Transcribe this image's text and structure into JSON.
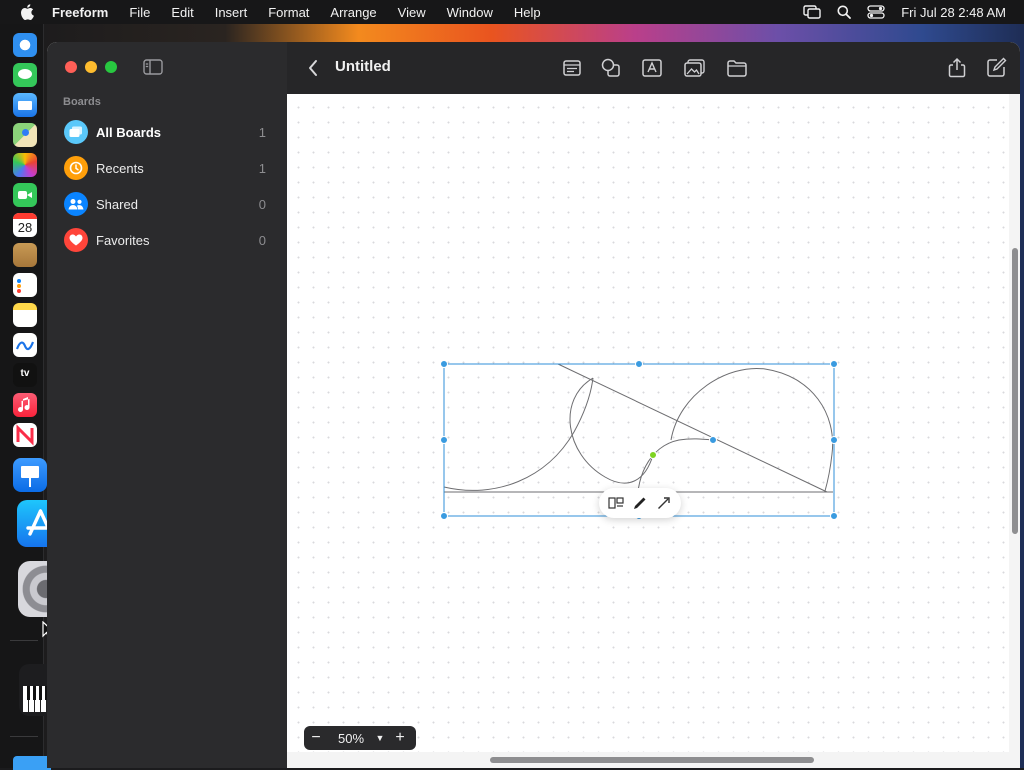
{
  "menubar": {
    "app_name": "Freeform",
    "items": [
      "File",
      "Edit",
      "Insert",
      "Format",
      "Arrange",
      "View",
      "Window",
      "Help"
    ],
    "clock": "Fri Jul 28  2:48 AM"
  },
  "dock": {
    "apps": [
      "safari",
      "messages",
      "mail",
      "maps",
      "photos",
      "facetime",
      "calendar",
      "notes-brown",
      "reminders",
      "notes",
      "freeform",
      "tv",
      "music",
      "news",
      "keynote",
      "app-store",
      "system-settings",
      "piano",
      "finder-folder"
    ],
    "calendar_day": "28",
    "tv_label": "tv"
  },
  "sidebar": {
    "section_title": "Boards",
    "items": [
      {
        "label": "All Boards",
        "count": "1",
        "icon": "boards-icon",
        "color": "#5ac8fa"
      },
      {
        "label": "Recents",
        "count": "1",
        "icon": "clock-icon",
        "color": "#ff9f0a"
      },
      {
        "label": "Shared",
        "count": "0",
        "icon": "people-icon",
        "color": "#0a84ff"
      },
      {
        "label": "Favorites",
        "count": "0",
        "icon": "heart-icon",
        "color": "#ff453a"
      }
    ]
  },
  "toolbar": {
    "title": "Untitled",
    "tools": [
      "sticky-note-icon",
      "shapes-icon",
      "text-box-icon",
      "media-icon",
      "files-icon"
    ],
    "actions": [
      "share-icon",
      "new-board-icon"
    ]
  },
  "canvas": {
    "selection_color": "#2f8fd8",
    "handle_color": "#3a9be0",
    "control_point_color": "#7ed321",
    "context_toolbar": [
      "arrange-icon",
      "pen-icon",
      "connector-icon"
    ]
  },
  "zoom": {
    "value": "50%",
    "minus": "−",
    "plus": "+"
  }
}
